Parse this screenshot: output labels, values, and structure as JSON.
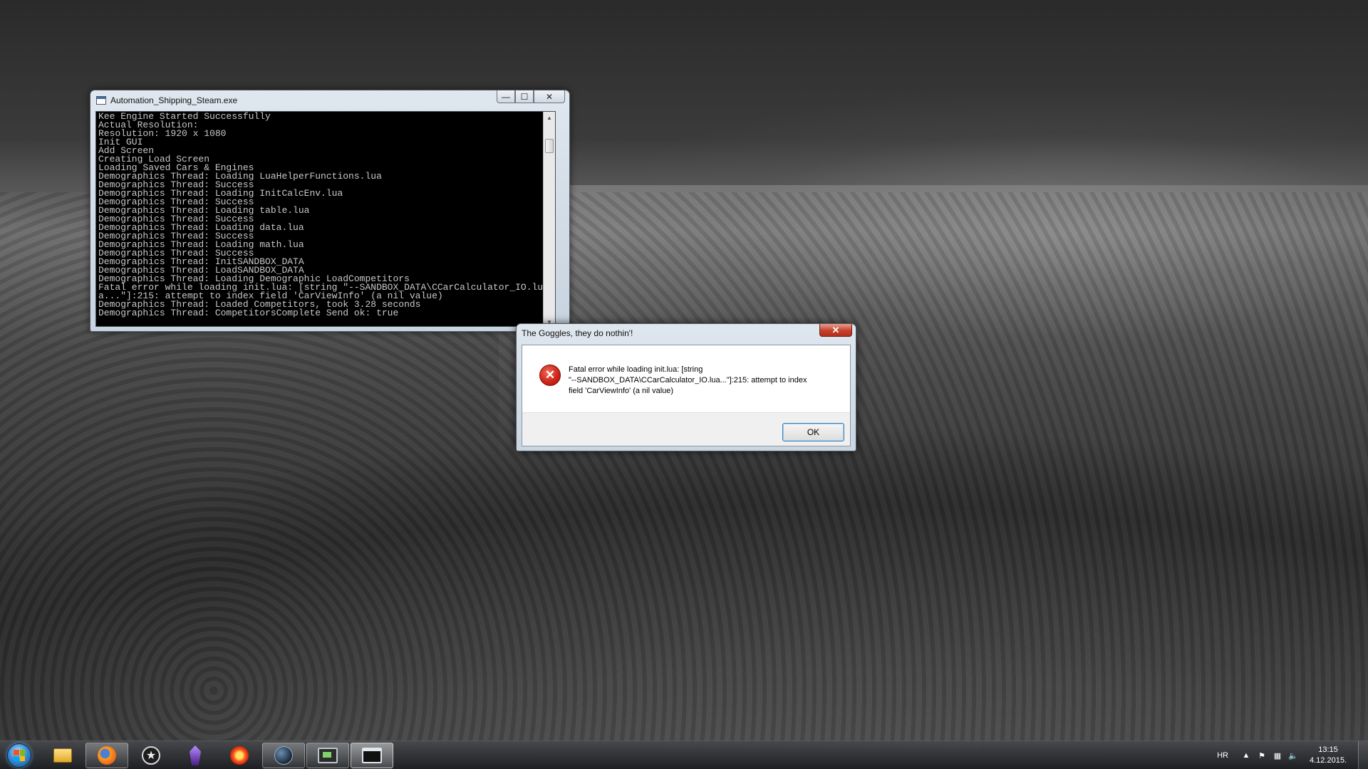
{
  "console_window": {
    "title": "Automation_Shipping_Steam.exe",
    "buttons": {
      "minimize": "—",
      "maximize": "☐",
      "close": "✕"
    },
    "lines": [
      "Kee Engine Started Successfully",
      "Actual Resolution:",
      "Resolution: 1920 x 1080",
      "Init GUI",
      "Add Screen",
      "Creating Load Screen",
      "Loading Saved Cars & Engines",
      "Demographics Thread: Loading LuaHelperFunctions.lua",
      "Demographics Thread: Success",
      "Demographics Thread: Loading InitCalcEnv.lua",
      "Demographics Thread: Success",
      "Demographics Thread: Loading table.lua",
      "Demographics Thread: Success",
      "Demographics Thread: Loading data.lua",
      "Demographics Thread: Success",
      "Demographics Thread: Loading math.lua",
      "Demographics Thread: Success",
      "Demographics Thread: InitSANDBOX_DATA",
      "Demographics Thread: LoadSANDBOX_DATA",
      "Demographics Thread: Loading Demographic LoadCompetitors",
      "Fatal error while loading init.lua: [string \"--SANDBOX_DATA\\CCarCalculator_IO.lu",
      "a...\"]:215: attempt to index field 'CarViewInfo' (a nil value)",
      "Demographics Thread: Loaded Competitors, took 3.28 seconds",
      "Demographics Thread: CompetitorsComplete Send ok: true"
    ]
  },
  "dialog": {
    "title": "The Goggles, they do nothin'!",
    "close_label": "✕",
    "icon": "error-icon",
    "message_line1": "Fatal error while loading init.lua: [string",
    "message_line2": "\"--SANDBOX_DATA\\CCarCalculator_IO.lua...\"]:215: attempt to index",
    "message_line3": "field 'CarViewInfo' (a nil value)",
    "ok_label": "OK"
  },
  "taskbar": {
    "pinned": [
      {
        "name": "file-explorer-icon"
      },
      {
        "name": "firefox-icon"
      },
      {
        "name": "star-emblem-icon"
      },
      {
        "name": "purple-crystal-icon"
      },
      {
        "name": "red-burst-icon"
      },
      {
        "name": "steam-icon"
      },
      {
        "name": "monitor-app-icon"
      },
      {
        "name": "console-window-icon"
      }
    ],
    "tray": {
      "language": "HR",
      "show_hidden": "▲",
      "time": "13:15",
      "date": "4.12.2015."
    }
  }
}
